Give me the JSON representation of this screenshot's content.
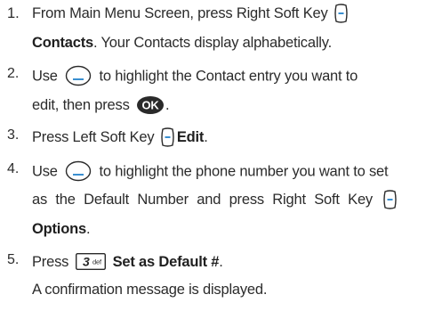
{
  "steps": [
    {
      "number": "1.",
      "line1": "From Main Menu Screen, press Right Soft Key",
      "line2_bold": "Contacts",
      "line2_rest": ". Your Contacts display alphabetically."
    },
    {
      "number": "2.",
      "line1_a": "Use",
      "line1_b": "to highlight the Contact entry you want to",
      "line2_a": "edit, then press",
      "line2_b": "."
    },
    {
      "number": "3.",
      "line1_a": "Press Left Soft Key",
      "line1_bold": "Edit",
      "line1_b": "."
    },
    {
      "number": "4.",
      "line1_a": "Use",
      "line1_b": "to highlight the phone number you want to set",
      "line2": "as the Default Number and press Right Soft Key",
      "line3_bold": "Options",
      "line3_rest": "."
    },
    {
      "number": "5.",
      "line1_a": "Press",
      "line1_bold": "Set as Default #",
      "line1_b": ".",
      "line2": "A confirmation message is displayed."
    }
  ],
  "keys": {
    "ok_label": "OK",
    "key3_digit": "3",
    "key3_letters": "def"
  },
  "colors": {
    "text": "#2b2b2b",
    "icon_accent": "#3a8fd0",
    "icon_dark": "#2a2a2a"
  }
}
